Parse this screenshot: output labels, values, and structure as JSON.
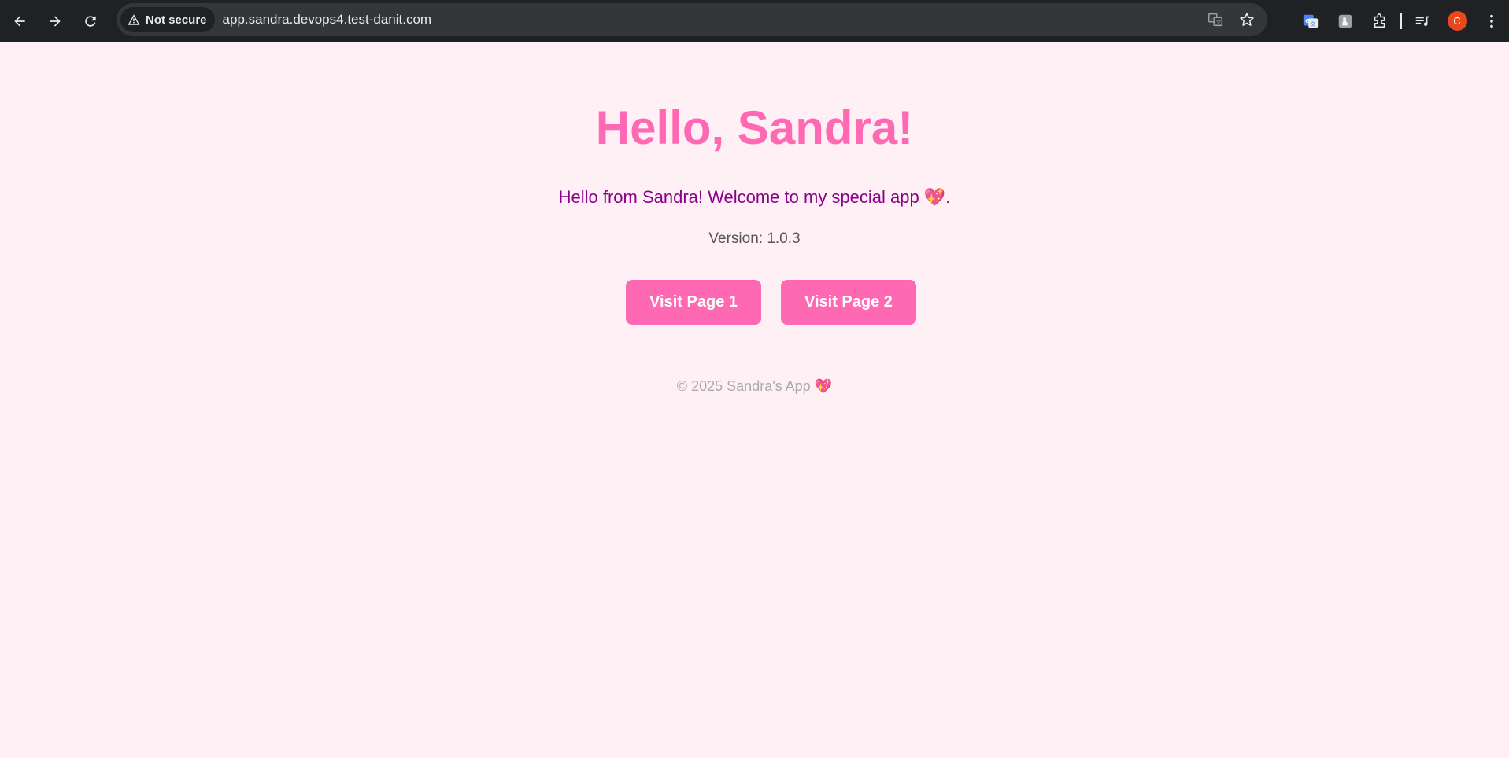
{
  "browser": {
    "security_label": "Not secure",
    "url": "app.sandra.devops4.test-danit.com",
    "profile_initial": "C",
    "icons": [
      "back-icon",
      "forward-icon",
      "reload-icon",
      "warning-icon",
      "translate-icon",
      "star-icon",
      "google-translate-extension-icon",
      "extension-icon",
      "puzzle-icon",
      "reading-list-icon",
      "more-icon"
    ]
  },
  "page": {
    "title": "Hello, Sandra!",
    "welcome_text": "Hello from Sandra! Welcome to my special app",
    "welcome_emoji": "💖",
    "welcome_suffix": ".",
    "version": "Version: 1.0.3",
    "buttons": [
      {
        "label": "Visit Page 1"
      },
      {
        "label": "Visit Page 2"
      }
    ],
    "footer_text": "© 2025 Sandra's App",
    "footer_emoji": "💖"
  },
  "colors": {
    "background": "#fff0f6",
    "accent": "#ff69b4",
    "welcome": "#8b008b",
    "chrome": "#202124"
  }
}
